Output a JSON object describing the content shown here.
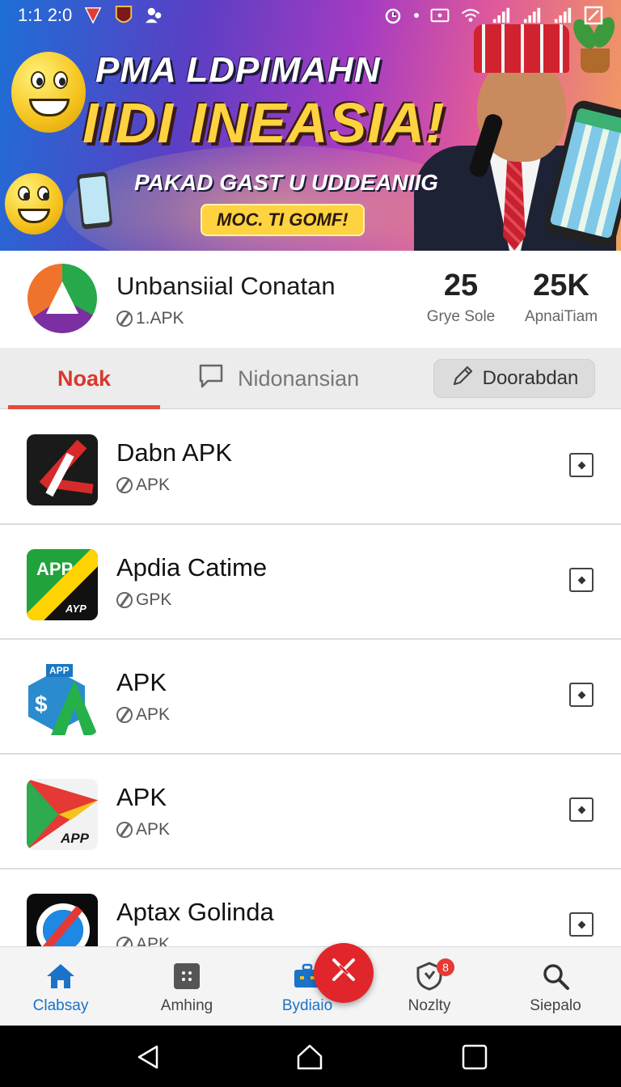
{
  "status_bar": {
    "time": "1:1 2:0"
  },
  "banner": {
    "headline_1": "PMA LDPIMAHN",
    "headline_2": "IIDI INEASIA!",
    "headline_3": "PAKAD GAST U UDDEANIIG",
    "cta": "MOC. TI GOMF!"
  },
  "app_header": {
    "title": "Unbansiial Conatan",
    "subtitle": "1.APK",
    "stats": [
      {
        "value": "25",
        "label": "Grye Sole"
      },
      {
        "value": "25K",
        "label": "ApnaiTiam"
      }
    ]
  },
  "tabs": {
    "active_label": "Noak",
    "second_label": "Nidonansian",
    "button_label": "Doorabdan"
  },
  "list": {
    "items": [
      {
        "title": "Dabn APK",
        "subtitle": "APK",
        "icon": "red-tools-icon"
      },
      {
        "title": "Apdia Catime",
        "subtitle": "GPK",
        "icon": "app-green-yellow-icon"
      },
      {
        "title": "APK",
        "subtitle": "APK",
        "icon": "apk-dollar-icon"
      },
      {
        "title": "APK",
        "subtitle": "APK",
        "icon": "play-app-icon"
      },
      {
        "title": "Aptax Golinda",
        "subtitle": "APK",
        "icon": "blue-ring-icon"
      }
    ]
  },
  "bottom_nav": {
    "items": [
      {
        "label": "Clabsay",
        "icon": "home-icon",
        "active": true
      },
      {
        "label": "Amhing",
        "icon": "apps-grid-icon",
        "active": false
      },
      {
        "label": "Bydiaio",
        "icon": "briefcase-icon",
        "active": true
      },
      {
        "label": "Nozlty",
        "icon": "shield-notification-icon",
        "badge": "8",
        "active": false
      },
      {
        "label": "Siepalo",
        "icon": "search-icon",
        "active": false
      }
    ],
    "fab_icon": "close-x-icon"
  },
  "colors": {
    "accent_red": "#e44b3c",
    "active_blue": "#1a73c8",
    "fab_red": "#e0262b"
  }
}
